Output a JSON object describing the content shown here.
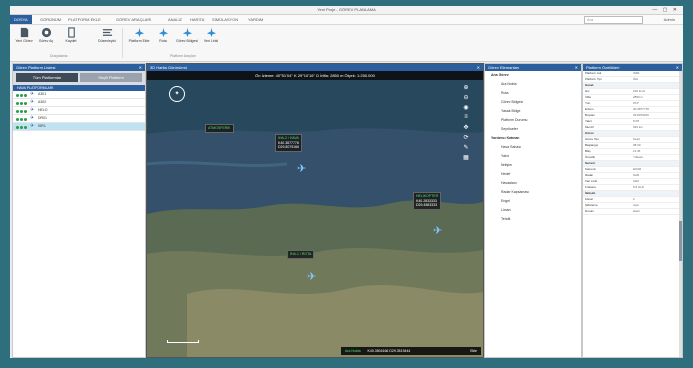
{
  "window": {
    "title": "Yeni Proje - GÖREV PLANLAMA",
    "controls": "— ▢ ✕"
  },
  "menu": {
    "tabs": [
      "DOSYA",
      "GÖRÜNÜM",
      "PLATFORM EKLE",
      "GÖREV ARAÇLARI",
      "ANALİZ",
      "HARİTA",
      "SİMÜLASYON",
      "YARDIM"
    ],
    "search_placeholder": "Ara",
    "user": "Admin"
  },
  "ribbon": {
    "buttons": [
      {
        "label": "Yeni Görev",
        "icon": "new-file-icon"
      },
      {
        "label": "Görev Aç",
        "icon": "open-icon"
      },
      {
        "label": "Kaydet",
        "icon": "save-icon"
      },
      {
        "label": "Düzenleyici",
        "icon": "editor-icon"
      },
      {
        "label": "Platform Ekle",
        "icon": "aircraft-add-icon"
      },
      {
        "label": "Rota",
        "icon": "route-icon"
      },
      {
        "label": "Görev Bölgesi",
        "icon": "area-icon"
      },
      {
        "label": "Veri Linki",
        "icon": "link-icon"
      }
    ],
    "group_labels": [
      "Dosyalama",
      "Platform Araçları"
    ]
  },
  "left_panel": {
    "title": "Görev Platform Listesi",
    "tab_all": "Tüm Platformlar",
    "tab_sel": "Seçili Platform",
    "group": "HAVA PLATFORMLARI",
    "rows": [
      {
        "name": "A301",
        "selected": false
      },
      {
        "name": "A302",
        "selected": false
      },
      {
        "name": "HELO",
        "selected": false
      },
      {
        "name": "DR01",
        "selected": false
      },
      {
        "name": "ISR1",
        "selected": true
      }
    ]
  },
  "map": {
    "title": "3D Harita Görünümü",
    "top_info": "Ön İzleme: 40°51'04'' K  29°10'16'' D  İrtifa: 2850 m  Ölçek: 1:250.000",
    "callouts": [
      {
        "name": "ATMOSFERİK",
        "line1": "",
        "line2": ""
      },
      {
        "name": "İHA-2 / HAVA",
        "line1": "K40.3877778",
        "line2": "D29.8079166"
      },
      {
        "name": "HELİKOPTER",
        "line1": "K40.2833333",
        "line2": "D29.4583333"
      },
      {
        "name": "İHA-1 / ROTA",
        "line1": "",
        "line2": ""
      }
    ],
    "bottom_label": "Ara Nokta",
    "bottom_coords": "K40.3504166 D29.3519444",
    "bottom_btn": "Ekle"
  },
  "tree_panel": {
    "title": "Görev Elemanları",
    "groups": [
      {
        "name": "Ana Görev",
        "items": [
          "Ara Nokta",
          "Rota",
          "Görev Bölgesi",
          "Yasak Bölge",
          "Platform Durumu",
          "Seyrüsefer"
        ]
      },
      {
        "name": "Yardımcı Katman",
        "items": [
          "Hava Sahası",
          "Yakıt",
          "İletişim",
          "Hedef",
          "Havaalanı",
          "Radar Kapsaması",
          "Engel",
          "Liman",
          "Tehdit"
        ]
      }
    ]
  },
  "prop_panel": {
    "title": "Platform Özellikleri",
    "rows": [
      {
        "k": "Platform Adı",
        "v": "ISR1",
        "sec": false
      },
      {
        "k": "Platform Tipi",
        "v": "İHA",
        "sec": false
      },
      {
        "k": "Genel",
        "v": "",
        "sec": true
      },
      {
        "k": "Hız",
        "v": "220 km/s",
        "sec": false
      },
      {
        "k": "İrtifa",
        "v": "2850 m",
        "sec": false
      },
      {
        "k": "Yön",
        "v": "074°",
        "sec": false
      },
      {
        "k": "Enlem",
        "v": "40.3877778",
        "sec": false
      },
      {
        "k": "Boylam",
        "v": "29.8079166",
        "sec": false
      },
      {
        "k": "Yakıt",
        "v": "%78",
        "sec": false
      },
      {
        "k": "Menzil",
        "v": "640 km",
        "sec": false
      },
      {
        "k": "Görev",
        "v": "",
        "sec": true
      },
      {
        "k": "Görev Tipi",
        "v": "Keşif",
        "sec": false
      },
      {
        "k": "Başlangıç",
        "v": "08:30",
        "sec": false
      },
      {
        "k": "Bitiş",
        "v": "11:45",
        "sec": false
      },
      {
        "k": "Öncelik",
        "v": "Yüksek",
        "sec": false
      },
      {
        "k": "Sensör",
        "v": "",
        "sec": true
      },
      {
        "k": "Kamera",
        "v": "EO/IR",
        "sec": false
      },
      {
        "k": "Radar",
        "v": "SAR",
        "sec": false
      },
      {
        "k": "Veri Linki",
        "v": "Aktif",
        "sec": false
      },
      {
        "k": "Frekans",
        "v": "5.8 GHz",
        "sec": false
      },
      {
        "k": "İletişim",
        "v": "",
        "sec": true
      },
      {
        "k": "Kanal",
        "v": "2",
        "sec": false
      },
      {
        "k": "Şifreleme",
        "v": "Açık",
        "sec": false
      },
      {
        "k": "Durum",
        "v": "Hazır",
        "sec": false
      }
    ]
  }
}
